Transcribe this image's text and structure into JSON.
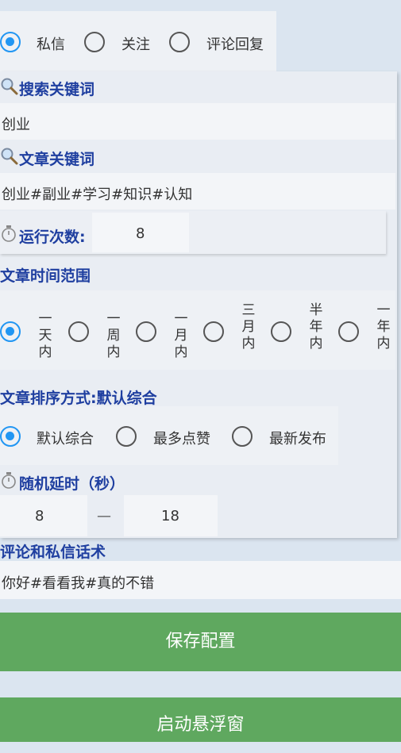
{
  "message_type": {
    "options": [
      "私信",
      "关注",
      "评论回复"
    ],
    "selected": "私信"
  },
  "search_keyword": {
    "label": "搜索关键词",
    "value": "创业",
    "icon": "search-icon"
  },
  "article_keyword": {
    "label": "文章关键词",
    "value": "创业#副业#学习#知识#认知",
    "icon": "search-icon"
  },
  "run_count": {
    "label": "运行次数:",
    "value": "8",
    "icon": "stopwatch-icon"
  },
  "time_range": {
    "label": "文章时间范围",
    "options": [
      "一天内",
      "一周内",
      "一月内",
      "三月内",
      "半年内",
      "一年内"
    ],
    "selected": "一天内"
  },
  "sort": {
    "label": "文章排序方式:默认综合",
    "options": [
      "默认综合",
      "最多点赞",
      "最新发布"
    ],
    "selected": "默认综合"
  },
  "delay": {
    "label": "随机延时（秒）",
    "min": "8",
    "separator": "—",
    "max": "18",
    "icon": "stopwatch-icon"
  },
  "script": {
    "label": "评论和私信话术",
    "value": "你好#看看我#真的不错"
  },
  "buttons": {
    "save": "保存配置",
    "float": "启动悬浮窗"
  },
  "colors": {
    "accent": "#2196f3",
    "button": "#5fa85f",
    "heading": "#1f3fa0"
  }
}
